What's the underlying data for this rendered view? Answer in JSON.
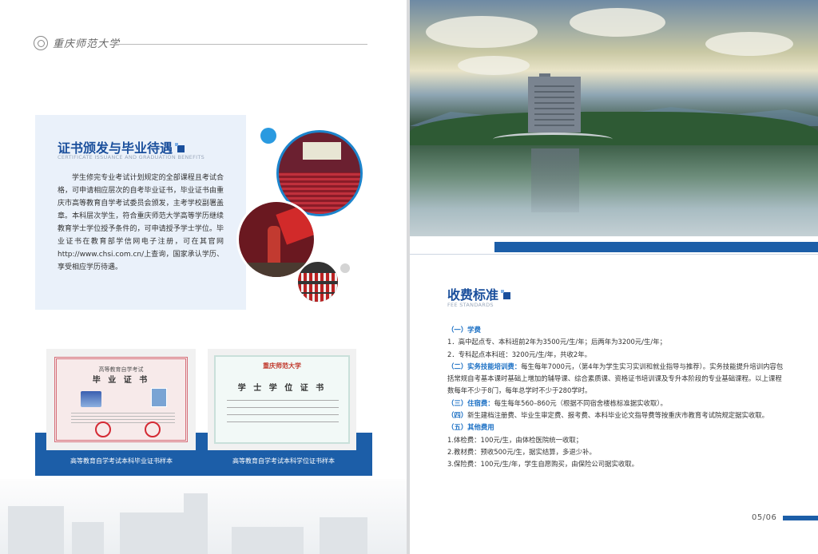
{
  "left_page": {
    "logo_text": "重庆师范大学",
    "certificate_section": {
      "title": "证书颁发与毕业待遇",
      "subtitle": "CERTIFICATE ISSUANCE AND GRADUATION BENEFITS",
      "body": "学生修完专业考试计划规定的全部课程且考试合格，可申请相应层次的自考毕业证书，毕业证书由重庆市高等教育自学考试委员会颁发，主考学校副署盖章。本科层次学生，符合重庆师范大学高等学历继续教育学士学位授予条件的，可申请授予学士学位。毕业证书在教育部学信网电子注册，可在其官网http://www.chsi.com.cn/上查询，国家承认学历、享受相应学历待遇。"
    },
    "samples": [
      {
        "caption": "高等教育自学考试本科毕业证书样本",
        "doc_heading": "高等教育自学考试",
        "doc_title": "毕 业 证 书"
      },
      {
        "caption": "高等教育自学考试本科学位证书样本",
        "doc_school": "重庆师范大学",
        "doc_title": "学 士 学 位 证 书"
      }
    ]
  },
  "right_page": {
    "fee_section": {
      "title": "收费标准",
      "subtitle": "FEE STANDARDS",
      "lines": [
        {
          "head": "（一）学费",
          "text": ""
        },
        {
          "head": "",
          "text": "1．高中起点专、本科班前2年为3500元/生/年；后两年为3200元/生/年；"
        },
        {
          "head": "",
          "text": "2．专科起点本科班：3200元/生/年，共收2年。"
        },
        {
          "head": "（二）实务技能培训费：",
          "text": "每生每年7000元，（第4年为学生实习实训和就业指导与推荐）。实务技能提升培训内容包括常规自考基本课时基础上增加的辅导课、综合素质课、资格证书培训课及专升本阶段的专业基础课程。以上课程数每年不少于8门，每年总学时不少于280学时。"
        },
        {
          "head": "（三）住宿费：",
          "text": "每生每年560–860元（根据不同宿舍楼栋标准据实收取）。"
        },
        {
          "head": "（四）",
          "text": "新生建档注册费、毕业生审定费、报考费、本科毕业论文指导费等按重庆市教育考试院规定据实收取。"
        },
        {
          "head": "（五）其他费用",
          "text": ""
        },
        {
          "head": "",
          "text": "1.体检费：100元/生，由体检医院统一收取；"
        },
        {
          "head": "",
          "text": "2.教材费：预收500元/生，据实结算，多退少补。"
        },
        {
          "head": "",
          "text": "3.保险费：100元/生/年，学生自愿购买，由保险公司据实收取。"
        }
      ]
    },
    "page_number": "05/06"
  },
  "colors": {
    "accent_blue": "#1c5ea8",
    "title_blue": "#1a4f9c",
    "highlight_blue": "#1a6fc4",
    "panel_bg": "#eaf1fa"
  }
}
